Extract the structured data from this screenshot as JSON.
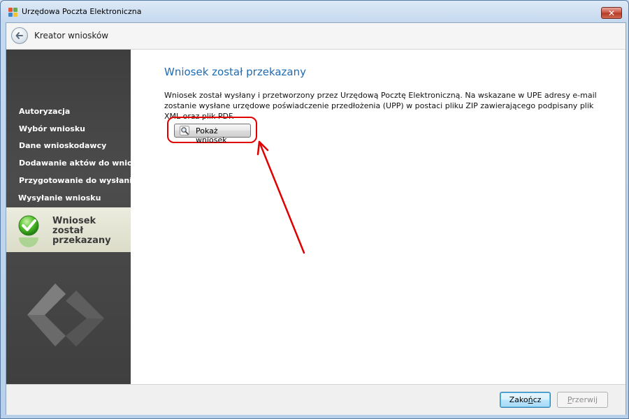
{
  "window": {
    "title": "Urzędowa Poczta Elektroniczna",
    "close_glyph": "✕"
  },
  "header": {
    "wizard_title": "Kreator wniosków",
    "back_icon": "back-arrow-icon"
  },
  "sidebar": {
    "steps": [
      {
        "label": "Autoryzacja"
      },
      {
        "label": "Wybór wniosku"
      },
      {
        "label": "Dane wnioskodawcy"
      },
      {
        "label": "Dodawanie aktów do wniosku"
      },
      {
        "label": "Przygotowanie do wysłania"
      },
      {
        "label": "Wysyłanie wniosku"
      }
    ],
    "current_step": {
      "label": "Wniosek został przekazany",
      "icon": "green-check-icon"
    }
  },
  "main": {
    "heading": "Wniosek został przekazany",
    "message": "Wniosek został wysłany i przetworzony przez Urzędową Pocztę Elektroniczną. Na wskazane w UPE adresy e-mail zostanie wysłane urzędowe poświadczenie przedłożenia (UPP) w postaci pliku ZIP zawierającego podpisany plik XML oraz plik PDF.",
    "show_button": {
      "label": "Pokaż wniosek",
      "icon": "magnifier-icon"
    }
  },
  "footer": {
    "finish_prefix": "Zako",
    "finish_underlined": "ń",
    "finish_suffix": "cz",
    "cancel_prefix": "",
    "cancel_underlined": "P",
    "cancel_suffix": "rzerwij"
  },
  "colors": {
    "accent_heading": "#1f6bb3",
    "sidebar_bg": "#444444",
    "annotation_red": "#e00000"
  }
}
